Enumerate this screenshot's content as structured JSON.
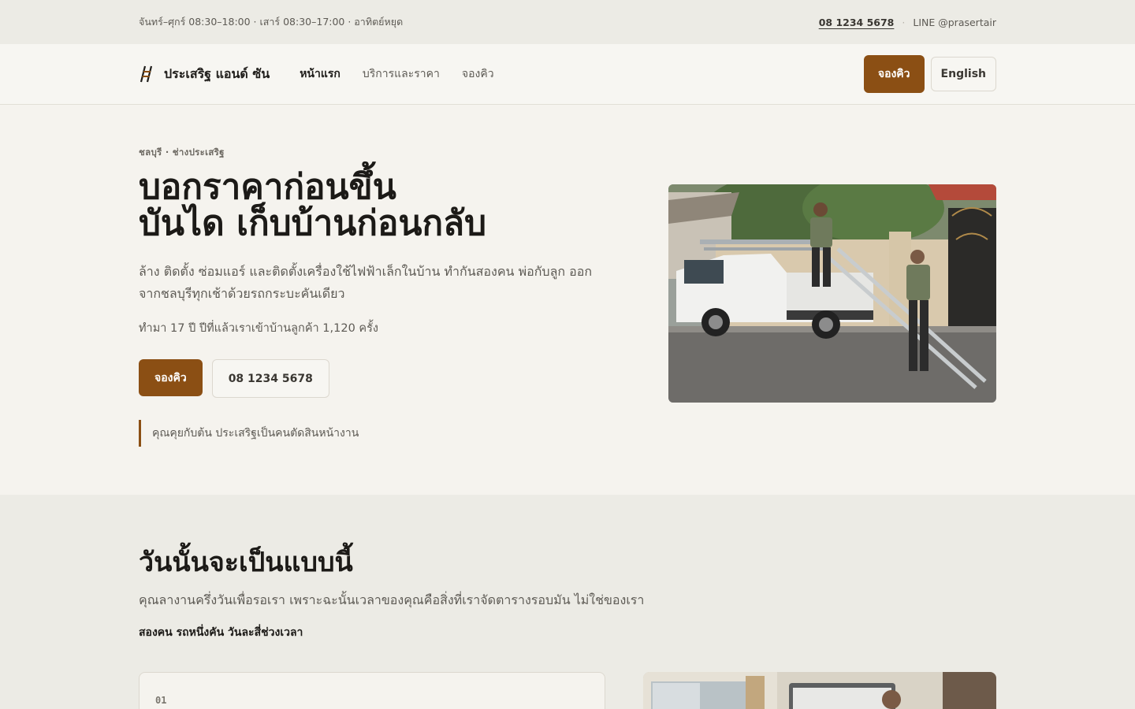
{
  "topbar": {
    "hours": "จันทร์–ศุกร์ 08:30–18:00 · เสาร์ 08:30–17:00 · อาทิตย์หยุด",
    "phone": "08 1234 5678",
    "separator": "·",
    "line": "LINE @prasertair"
  },
  "header": {
    "brand_name": "ประเสริฐ แอนด์ ซัน",
    "nav": [
      "หน้าแรก",
      "บริการและราคา",
      "จองคิว"
    ],
    "book_label": "จองคิว",
    "lang_label": "English"
  },
  "hero": {
    "eyebrow": "ชลบุรี · ช่างประเสริฐ",
    "title_line1": "บอกราคาก่อนขึ้น",
    "title_line2": "บันได เก็บบ้านก่อนกลับ",
    "description": "ล้าง ติดตั้ง ซ่อมแอร์ และติดตั้งเครื่องใช้ไฟฟ้าเล็กในบ้าน ทำกันสองคน พ่อกับลูก ออกจากชลบุรีทุกเช้าด้วยรถกระบะคันเดียว",
    "stat": "ทำมา 17 ปี ปีที่แล้วเราเข้าบ้านลูกค้า 1,120 ครั้ง",
    "book_label": "จองคิว",
    "phone_label": "08 1234 5678",
    "quote": "คุณคุยกับต้น ประเสริฐเป็นคนตัดสินหน้างาน"
  },
  "section2": {
    "title": "วันนั้นจะเป็นแบบนี้",
    "description": "คุณลางานครึ่งวันเพื่อรอเรา เพราะฉะนั้นเวลาของคุณคือสิ่งที่เราจัดตารางรอบมัน ไม่ใช่ของเรา",
    "subtitle": "สองคน รถหนึ่งคัน วันละสี่ช่วงเวลา",
    "card_number": "01"
  },
  "colors": {
    "accent": "#8b4f14",
    "background": "#f5f3ee",
    "topbar": "#ecebe5",
    "text": "#1f1d1a"
  },
  "icons": {
    "brand": "ladder-logo-icon"
  }
}
